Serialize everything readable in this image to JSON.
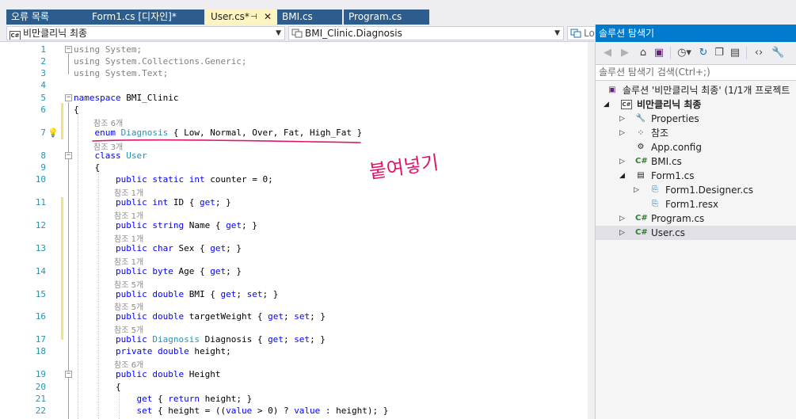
{
  "tabs": [
    {
      "label": "오류 목록"
    },
    {
      "label": "Form1.cs [디자인]*"
    },
    {
      "label": "User.cs*",
      "pin": "⊣",
      "close": "✕"
    },
    {
      "label": "BMI.cs"
    },
    {
      "label": "Program.cs"
    }
  ],
  "nav": {
    "project": "비만클리닉 최종",
    "type": "BMI_Clinic.Diagnosis",
    "member": "Lov"
  },
  "editor": {
    "line_numbers": [
      "1",
      "2",
      "3",
      "4",
      "5",
      "6",
      "7",
      "8",
      "9",
      "10",
      "11",
      "12",
      "13",
      "14",
      "15",
      "16",
      "17",
      "18",
      "19",
      "20",
      "21",
      "22"
    ],
    "refs": [
      "참조 6개",
      "참조 3개",
      "참조 1개",
      "참조 1개",
      "참조 1개",
      "참조 1개",
      "참조 5개",
      "참조 5개",
      "참조 5개",
      "참조 6개"
    ],
    "annotation": "붙여넣기"
  },
  "solution_explorer": {
    "title": "솔루션 탐색기",
    "search_placeholder": "솔루션 탐색기 검색(Ctrl+;)",
    "items": [
      {
        "label": "솔루션 '비만클리닉 최종' (1/1개 프로젝트"
      },
      {
        "label": "비만클리닉 최종"
      },
      {
        "label": "Properties"
      },
      {
        "label": "참조"
      },
      {
        "label": "App.config"
      },
      {
        "label": "BMI.cs"
      },
      {
        "label": "Form1.cs"
      },
      {
        "label": "Form1.Designer.cs"
      },
      {
        "label": "Form1.resx"
      },
      {
        "label": "Program.cs"
      },
      {
        "label": "User.cs"
      }
    ]
  },
  "colors": {
    "tab_inactive": "#2d5d8c",
    "tab_active": "#fdf4bf",
    "keyword": "#0000ff",
    "type": "#2b91af",
    "annotation_ink": "#e0186c",
    "panel_title": "#007acc"
  }
}
